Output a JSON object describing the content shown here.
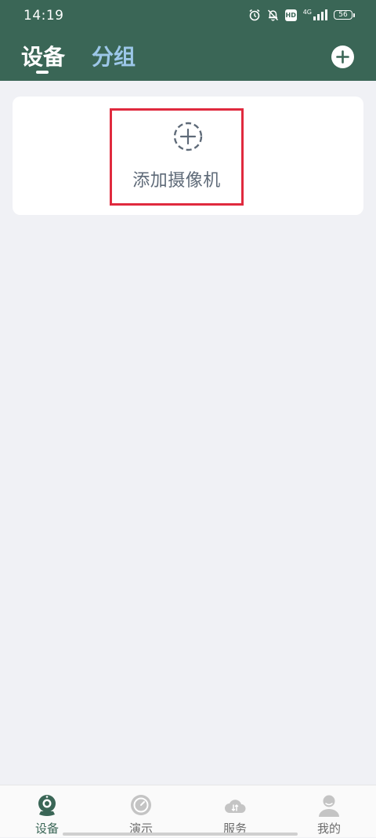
{
  "status_bar": {
    "time": "14:19",
    "network": "4G",
    "hd": "HD",
    "battery": "56"
  },
  "header": {
    "tabs": [
      {
        "label": "设备",
        "active": true
      },
      {
        "label": "分组",
        "active": false
      }
    ]
  },
  "main": {
    "add_camera_label": "添加摄像机"
  },
  "bottom_nav": {
    "items": [
      {
        "label": "设备",
        "icon": "camera-icon",
        "active": true
      },
      {
        "label": "演示",
        "icon": "demo-circle-icon",
        "active": false
      },
      {
        "label": "服务",
        "icon": "cloud-icon",
        "active": false
      },
      {
        "label": "我的",
        "icon": "person-icon",
        "active": false
      }
    ]
  },
  "colors": {
    "header_bg": "#3a6656",
    "page_bg": "#f0f1f5",
    "highlight_border": "#e02a3e",
    "inactive_tab": "#9cc7e8"
  }
}
